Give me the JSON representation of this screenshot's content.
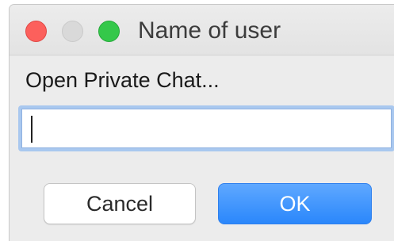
{
  "window": {
    "title": "Name of user"
  },
  "dialog": {
    "prompt": "Open Private Chat...",
    "input_value": "",
    "cancel_label": "Cancel",
    "ok_label": "OK"
  },
  "colors": {
    "close": "#fc605c",
    "minimize": "#d9d9d9",
    "zoom": "#34c84a",
    "accent": "#2a87fb"
  },
  "icons": {
    "close": "close-traffic-light-icon",
    "minimize": "minimize-traffic-light-icon",
    "zoom": "zoom-traffic-light-icon"
  }
}
